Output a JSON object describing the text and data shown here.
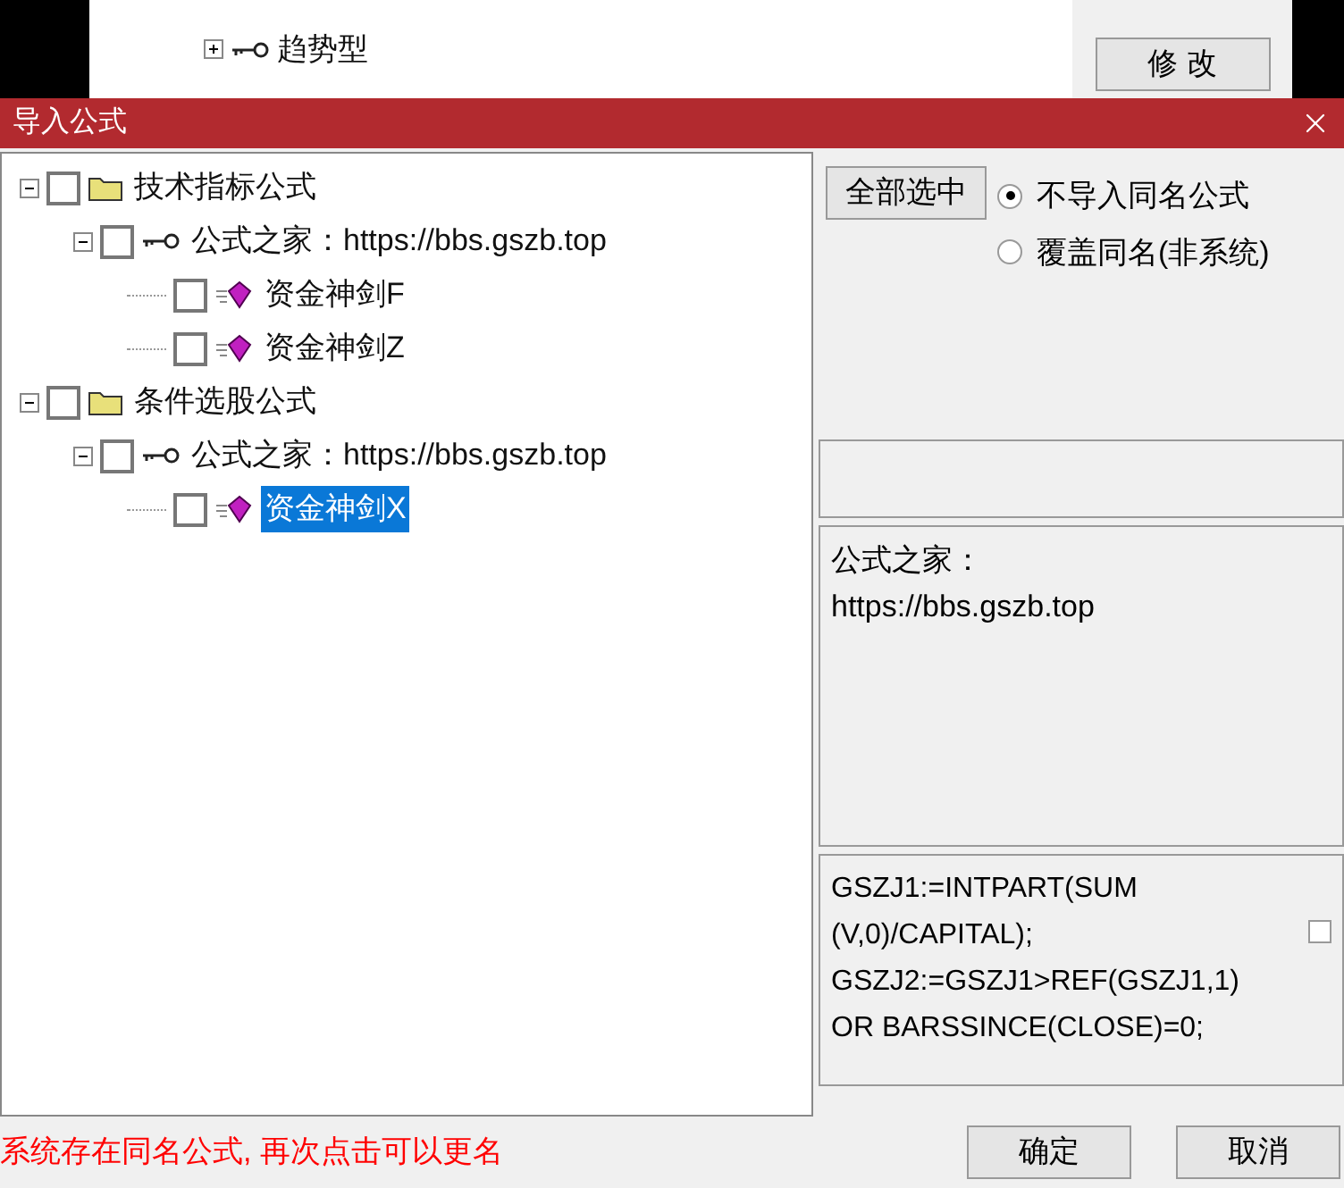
{
  "background_window": {
    "tree_items": [
      {
        "label": "趋势型",
        "expanded": false
      }
    ],
    "buttons": [
      "修 改"
    ]
  },
  "dialog": {
    "title": "导入公式",
    "tree": [
      {
        "kind": "folder",
        "label": "技术指标公式",
        "checked": false,
        "selected": false,
        "expanded": true,
        "children": [
          {
            "kind": "group",
            "label": "公式之家：https://bbs.gszb.top",
            "checked": false,
            "selected": false,
            "expanded": true,
            "children": [
              {
                "kind": "formula",
                "label": "资金神剑F",
                "checked": false,
                "selected": false
              },
              {
                "kind": "formula",
                "label": "资金神剑Z",
                "checked": false,
                "selected": false
              }
            ]
          }
        ]
      },
      {
        "kind": "folder",
        "label": "条件选股公式",
        "checked": false,
        "selected": false,
        "expanded": true,
        "children": [
          {
            "kind": "group",
            "label": "公式之家：https://bbs.gszb.top",
            "checked": false,
            "selected": false,
            "expanded": true,
            "children": [
              {
                "kind": "formula",
                "label": "资金神剑X",
                "checked": false,
                "selected": true
              }
            ]
          }
        ]
      }
    ],
    "select_all_button": "全部选中",
    "radios": [
      {
        "label": "不导入同名公式",
        "selected": true
      },
      {
        "label": "覆盖同名(非系统)",
        "selected": false
      }
    ],
    "description": "公式之家：\nhttps://bbs.gszb.top",
    "formula_text": "GSZJ1:=INTPART(SUM\n(V,0)/CAPITAL);\nGSZJ2:=GSZJ1>REF(GSZJ1,1)\nOR BARSSINCE(CLOSE)=0;",
    "formula_checkbox": {
      "checked": false
    },
    "status_message": "系统存在同名公式, 再次点击可以更名",
    "buttons": [
      "确定",
      "取消"
    ]
  }
}
